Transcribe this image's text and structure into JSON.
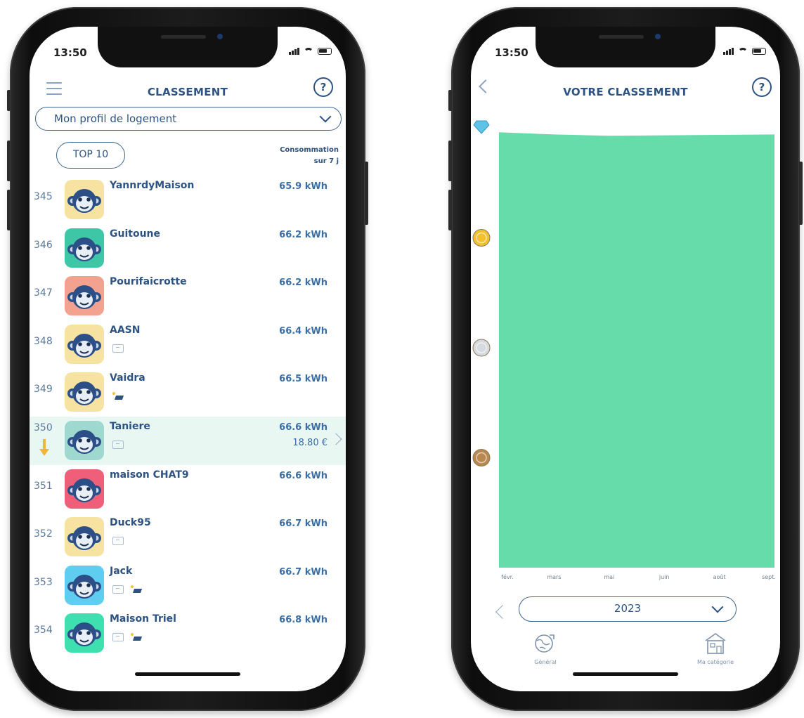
{
  "status_bar": {
    "time": "13:50"
  },
  "ranking_screen": {
    "title": "CLASSEMENT",
    "help_label": "?",
    "profile_select": {
      "value": "Mon profil de logement"
    },
    "top10_button": "TOP 10",
    "column_header": {
      "line1": "Consommation",
      "line2": "sur 7 j"
    },
    "rows": [
      {
        "rank": "345",
        "name": "YannrdyMaison",
        "consumption": "65.9 kWh",
        "avatar_color": "#f6e3a1",
        "house": false,
        "solar": false,
        "highlight": false
      },
      {
        "rank": "346",
        "name": "Guitoune",
        "consumption": "66.2 kWh",
        "avatar_color": "#3ec7a6",
        "house": false,
        "solar": false,
        "highlight": false
      },
      {
        "rank": "347",
        "name": "Pourifaicrotte",
        "consumption": "66.2 kWh",
        "avatar_color": "#f3a290",
        "house": false,
        "solar": false,
        "highlight": false
      },
      {
        "rank": "348",
        "name": "AASN",
        "consumption": "66.4 kWh",
        "avatar_color": "#f6e3a1",
        "house": true,
        "solar": false,
        "highlight": false
      },
      {
        "rank": "349",
        "name": "Vaidra",
        "consumption": "66.5 kWh",
        "avatar_color": "#f6e3a1",
        "house": false,
        "solar": true,
        "highlight": false
      },
      {
        "rank": "350",
        "name": "Taniere",
        "consumption": "66.6 kWh",
        "price": "18.80 €",
        "avatar_color": "#9fd8cf",
        "house": true,
        "solar": false,
        "highlight": true
      },
      {
        "rank": "351",
        "name": "maison CHAT9",
        "consumption": "66.6 kWh",
        "avatar_color": "#ef5f7a",
        "house": false,
        "solar": false,
        "highlight": false
      },
      {
        "rank": "352",
        "name": "Duck95",
        "consumption": "66.7 kWh",
        "avatar_color": "#f6e3a1",
        "house": true,
        "solar": false,
        "highlight": false
      },
      {
        "rank": "353",
        "name": "Jack",
        "consumption": "66.7 kWh",
        "avatar_color": "#5fcdf0",
        "house": true,
        "solar": true,
        "highlight": false
      },
      {
        "rank": "354",
        "name": "Maison Triel",
        "consumption": "66.8 kWh",
        "avatar_color": "#3ee0b0",
        "house": true,
        "solar": true,
        "highlight": false
      }
    ]
  },
  "evolution_screen": {
    "title": "VOTRE CLASSEMENT",
    "help_label": "?",
    "year_select": {
      "value": "2023"
    },
    "tabs": [
      {
        "label": "Général"
      },
      {
        "label": "Ma catégorie"
      }
    ],
    "level_markers": [
      "diamond",
      "gold",
      "silver",
      "bronze"
    ]
  },
  "chart_data": {
    "type": "area",
    "x": [
      "févr.",
      "mars",
      "mai",
      "juin",
      "août",
      "sept."
    ],
    "series": [
      {
        "values": [
          0.99,
          0.985,
          0.982,
          0.983,
          0.984,
          0.985
        ],
        "color": "#66dcab"
      }
    ],
    "ylim": [
      0,
      1
    ],
    "y_markers": [
      {
        "level": "diamond",
        "value": 1.0
      },
      {
        "level": "gold",
        "value": 0.75
      },
      {
        "level": "silver",
        "value": 0.5
      },
      {
        "level": "bronze",
        "value": 0.25
      }
    ],
    "grid": true
  }
}
